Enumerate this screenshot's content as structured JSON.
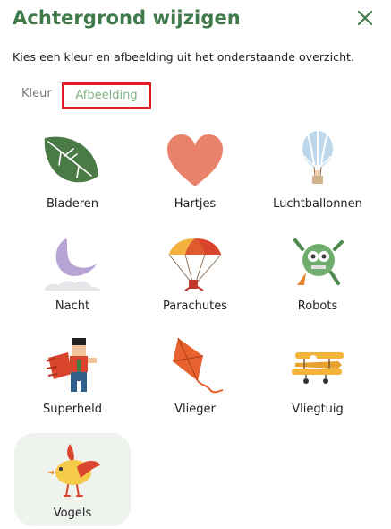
{
  "dialog": {
    "title": "Achtergrond wijzigen",
    "subtitle": "Kies een kleur en afbeelding uit het onderstaande overzicht.",
    "close_icon": "close-icon"
  },
  "tabs": [
    {
      "label": "Kleur",
      "active": false
    },
    {
      "label": "Afbeelding",
      "active": true
    }
  ],
  "images": [
    {
      "label": "Bladeren",
      "icon": "leaf-icon",
      "selected": false
    },
    {
      "label": "Hartjes",
      "icon": "heart-icon",
      "selected": false
    },
    {
      "label": "Luchtballonnen",
      "icon": "hot-air-balloon-icon",
      "selected": false
    },
    {
      "label": "Nacht",
      "icon": "moon-icon",
      "selected": false
    },
    {
      "label": "Parachutes",
      "icon": "parachute-icon",
      "selected": false
    },
    {
      "label": "Robots",
      "icon": "robot-icon",
      "selected": false
    },
    {
      "label": "Superheld",
      "icon": "superhero-icon",
      "selected": false
    },
    {
      "label": "Vlieger",
      "icon": "kite-icon",
      "selected": false
    },
    {
      "label": "Vliegtuig",
      "icon": "airplane-icon",
      "selected": false
    },
    {
      "label": "Vogels",
      "icon": "bird-icon",
      "selected": true
    }
  ],
  "colors": {
    "title": "#3f7a4a",
    "tab_active": "#7fb285",
    "highlight_box": "#e11b22",
    "selected_tile_bg": "#eef3ee"
  }
}
